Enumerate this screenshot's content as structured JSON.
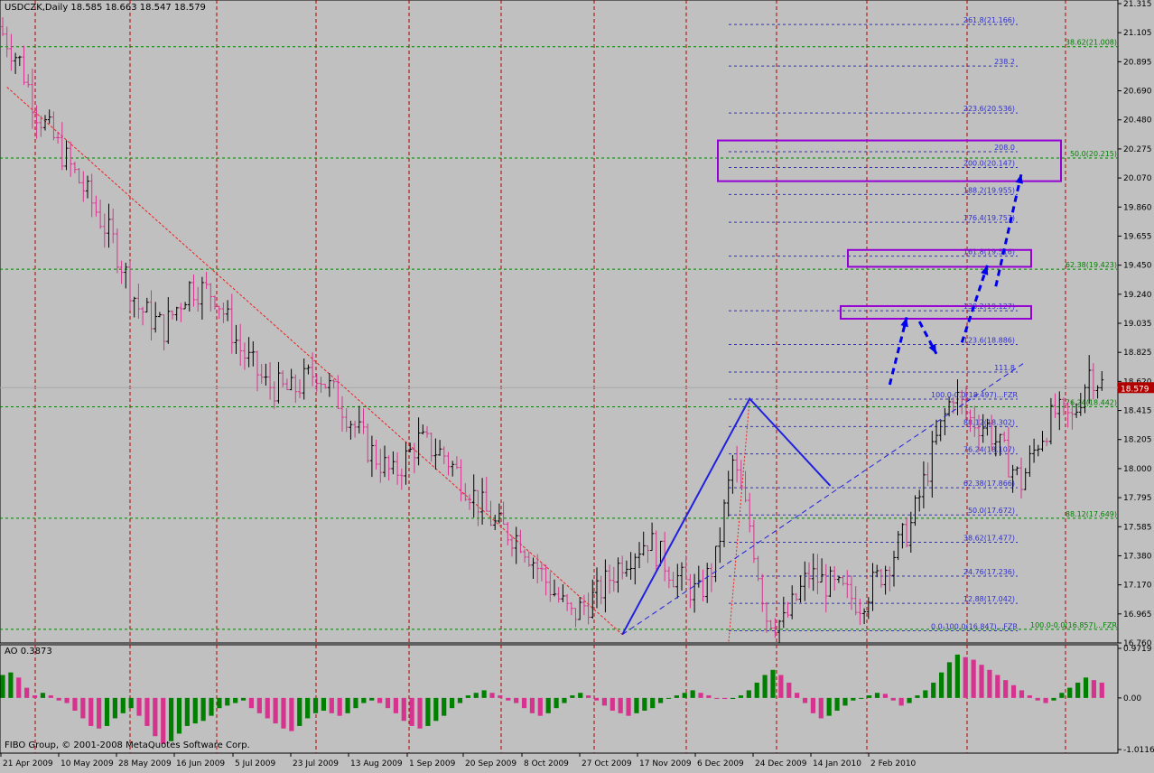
{
  "header": {
    "symbol_line": "USDCZK,Daily  18.585 18.663 18.547 18.579"
  },
  "indicator": {
    "label": "AO 0.3873",
    "copyright": "FIBO Group, © 2001-2008 MetaQuotes Software Corp."
  },
  "colors": {
    "background": "#c0c0c0",
    "bull_bar": "#000000",
    "bear_bar": "#d6338f",
    "ao_up": "#008000",
    "ao_down": "#d6338f",
    "period_separator": "#b00000",
    "fibo_blue": "#3030d0",
    "fibo_green": "#008000",
    "projection": "#0000ee",
    "box": "#9400d3",
    "price_tag": "#b00000"
  },
  "chart_data": [
    {
      "type": "candlestick",
      "title": "USDCZK,Daily",
      "ohlc_last": {
        "open": 18.585,
        "high": 18.663,
        "low": 18.547,
        "close": 18.579
      },
      "current_price": "18.579",
      "ylim": [
        16.76,
        21.315
      ],
      "y_ticks": [
        "21.315",
        "21.105",
        "20.895",
        "20.690",
        "20.480",
        "20.275",
        "20.070",
        "19.860",
        "19.655",
        "19.450",
        "19.240",
        "19.035",
        "18.825",
        "18.620",
        "18.415",
        "18.205",
        "18.000",
        "17.795",
        "17.585",
        "17.380",
        "17.170",
        "16.965",
        "16.760"
      ],
      "x_ticks": [
        "21 Apr 2009",
        "10 May 2009",
        "28 May 2009",
        "16 Jun 2009",
        "5 Jul 2009",
        "23 Jul 2009",
        "13 Aug 2009",
        "1 Sep 2009",
        "20 Sep 2009",
        "8 Oct 2009",
        "27 Oct 2009",
        "17 Nov 2009",
        "6 Dec 2009",
        "24 Dec 2009",
        "14 Jan 2010",
        "2 Feb 2010"
      ],
      "period_separators": [
        "Apr 2009",
        "May 2009",
        "Jun 2009",
        "Jul 2009",
        "Aug 2009",
        "Sep 2009",
        "Oct 2009",
        "Nov 2009",
        "Dec 2009",
        "Jan 2010",
        "Feb 2010",
        "Mar 2010"
      ],
      "price_path": [
        [
          0,
          21.1
        ],
        [
          4,
          20.9
        ],
        [
          8,
          20.55
        ],
        [
          14,
          20.25
        ],
        [
          20,
          19.95
        ],
        [
          26,
          19.62
        ],
        [
          32,
          19.15
        ],
        [
          38,
          19.0
        ],
        [
          44,
          19.3
        ],
        [
          50,
          19.25
        ],
        [
          56,
          18.85
        ],
        [
          62,
          18.6
        ],
        [
          68,
          18.55
        ],
        [
          74,
          18.7
        ],
        [
          80,
          18.45
        ],
        [
          86,
          18.15
        ],
        [
          92,
          17.95
        ],
        [
          98,
          18.2
        ],
        [
          104,
          18.1
        ],
        [
          110,
          17.85
        ],
        [
          116,
          17.6
        ],
        [
          122,
          17.5
        ],
        [
          128,
          17.2
        ],
        [
          134,
          16.95
        ],
        [
          140,
          17.1
        ],
        [
          146,
          17.35
        ],
        [
          152,
          17.5
        ],
        [
          158,
          17.25
        ],
        [
          164,
          17.1
        ],
        [
          168,
          17.35
        ],
        [
          172,
          18.05
        ],
        [
          176,
          17.6
        ],
        [
          180,
          16.95
        ],
        [
          184,
          16.9
        ],
        [
          190,
          17.25
        ],
        [
          196,
          17.15
        ],
        [
          202,
          17.05
        ],
        [
          208,
          17.3
        ],
        [
          214,
          17.6
        ],
        [
          220,
          18.2
        ],
        [
          224,
          18.55
        ],
        [
          228,
          18.35
        ],
        [
          232,
          18.3
        ],
        [
          236,
          18.1
        ],
        [
          240,
          17.9
        ],
        [
          244,
          18.2
        ],
        [
          248,
          18.4
        ],
        [
          252,
          18.35
        ],
        [
          256,
          18.7
        ],
        [
          259,
          18.6
        ]
      ],
      "fib_levels": [
        {
          "label": "261.8(21.166)",
          "value": 21.166
        },
        {
          "label": "238.2",
          "value": 20.87
        },
        {
          "label": "223.6(20.536)",
          "value": 20.536
        },
        {
          "label": "208.0",
          "value": 20.26
        },
        {
          "label": "200.0(20.147)",
          "value": 20.147
        },
        {
          "label": "188.2(19.955)",
          "value": 19.955
        },
        {
          "label": "176.4(19.757)",
          "value": 19.757
        },
        {
          "label": "161.8(19.516)",
          "value": 19.516
        },
        {
          "label": "138.2(19.127)",
          "value": 19.127
        },
        {
          "label": "123.6(18.886)",
          "value": 18.886
        },
        {
          "label": "111.8",
          "value": 18.69
        },
        {
          "label": "100.0-0.0(18.497)...FZR",
          "value": 18.497
        },
        {
          "label": "88.12(18.302)",
          "value": 18.302
        },
        {
          "label": "76.24(18.107)",
          "value": 18.107
        },
        {
          "label": "62.38(17.866)",
          "value": 17.866
        },
        {
          "label": "50.0(17.672)",
          "value": 17.672
        },
        {
          "label": "38.62(17.477)",
          "value": 17.477
        },
        {
          "label": "24.76(17.236)",
          "value": 17.236
        },
        {
          "label": "12.88(17.042)",
          "value": 17.042
        },
        {
          "label": "0.0-100.0(16.847)...FZR",
          "value": 16.847
        }
      ],
      "fib_levels_right": [
        {
          "label": "38.62(21.008)",
          "value": 21.008
        },
        {
          "label": "50.0(20.215)",
          "value": 20.215
        },
        {
          "label": "62.38(19.423)",
          "value": 19.423
        },
        {
          "label": "76.24(18.442)",
          "value": 18.442
        },
        {
          "label": "88.12(17.649)",
          "value": 17.649
        },
        {
          "label": "100.0-0.0(16.857)...FZR",
          "value": 16.857
        }
      ],
      "target_boxes": [
        {
          "top": 20.34,
          "bottom": 20.05
        },
        {
          "top": 19.56,
          "bottom": 19.44
        },
        {
          "top": 19.16,
          "bottom": 19.07
        }
      ],
      "projection_points": [
        [
          209,
          18.6
        ],
        [
          213,
          19.08
        ],
        [
          216,
          19.05
        ],
        [
          220,
          18.82
        ],
        [
          226,
          18.9
        ],
        [
          232,
          19.45
        ],
        [
          234,
          19.3
        ],
        [
          240,
          20.1
        ]
      ]
    },
    {
      "type": "bar",
      "title": "AO 0.3873",
      "value": 0.3873,
      "ylim": [
        -1.0116,
        0.9719
      ],
      "y_ticks": [
        "0.9719",
        "0.00",
        "-1.0116"
      ],
      "values": [
        0.45,
        0.5,
        0.4,
        0.2,
        0.05,
        0.1,
        0.05,
        -0.05,
        -0.1,
        -0.25,
        -0.4,
        -0.55,
        -0.6,
        -0.55,
        -0.4,
        -0.3,
        -0.2,
        -0.35,
        -0.55,
        -0.75,
        -0.9,
        -0.85,
        -0.7,
        -0.55,
        -0.5,
        -0.45,
        -0.35,
        -0.2,
        -0.15,
        -0.1,
        -0.05,
        -0.2,
        -0.3,
        -0.4,
        -0.5,
        -0.6,
        -0.65,
        -0.55,
        -0.4,
        -0.3,
        -0.25,
        -0.3,
        -0.35,
        -0.3,
        -0.2,
        -0.1,
        -0.05,
        -0.1,
        -0.2,
        -0.3,
        -0.45,
        -0.55,
        -0.6,
        -0.55,
        -0.45,
        -0.35,
        -0.2,
        -0.1,
        0.05,
        0.1,
        0.15,
        0.1,
        0.05,
        -0.05,
        -0.1,
        -0.2,
        -0.3,
        -0.35,
        -0.3,
        -0.2,
        -0.1,
        0.05,
        0.1,
        0.05,
        -0.05,
        -0.15,
        -0.25,
        -0.3,
        -0.35,
        -0.3,
        -0.25,
        -0.2,
        -0.1,
        0.0,
        0.05,
        0.1,
        0.15,
        0.1,
        0.05,
        0.0,
        -0.02,
        -0.02,
        0.05,
        0.15,
        0.3,
        0.45,
        0.55,
        0.45,
        0.3,
        0.1,
        -0.1,
        -0.3,
        -0.4,
        -0.35,
        -0.25,
        -0.15,
        -0.05,
        0.0,
        0.05,
        0.1,
        0.08,
        -0.05,
        -0.15,
        -0.1,
        0.05,
        0.15,
        0.3,
        0.5,
        0.7,
        0.85,
        0.8,
        0.75,
        0.65,
        0.55,
        0.45,
        0.35,
        0.25,
        0.15,
        0.05,
        -0.05,
        -0.1,
        -0.05,
        0.1,
        0.2,
        0.3,
        0.4,
        0.35,
        0.3
      ]
    }
  ]
}
